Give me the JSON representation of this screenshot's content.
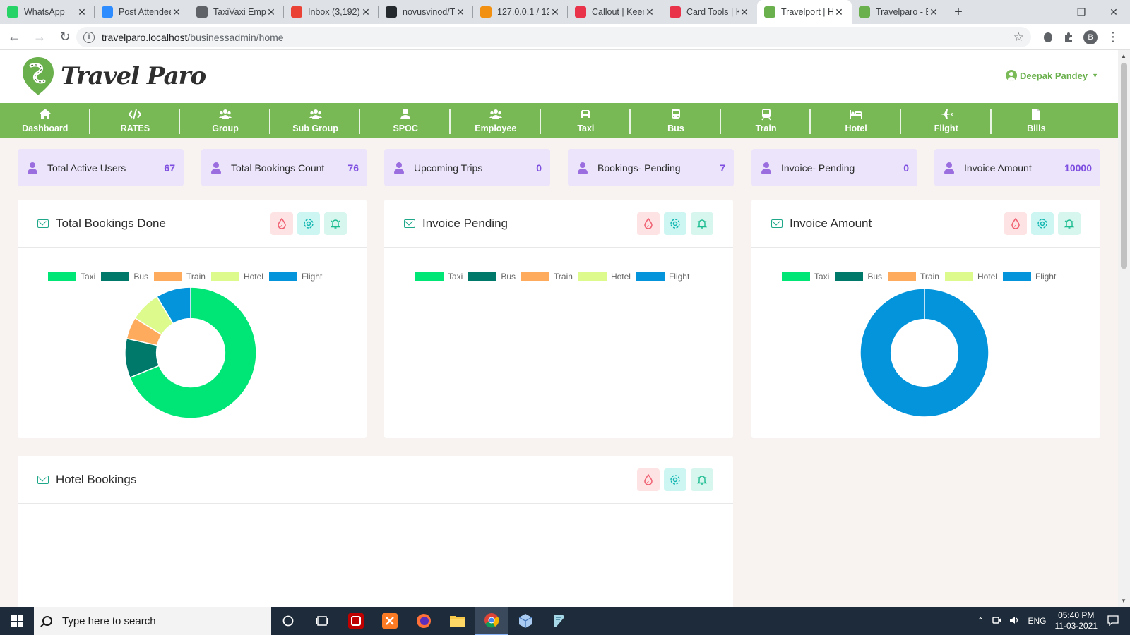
{
  "browser": {
    "tabs": [
      {
        "title": "WhatsApp",
        "icon": "whatsapp-icon",
        "color": "#25d366"
      },
      {
        "title": "Post Attendee",
        "icon": "zoom-icon",
        "color": "#2d8cff"
      },
      {
        "title": "TaxiVaxi Empl",
        "icon": "globe-icon",
        "color": "#5f6368"
      },
      {
        "title": "Inbox (3,192)",
        "icon": "gmail-icon",
        "color": "#ea4335"
      },
      {
        "title": "novusvinod/Tr",
        "icon": "github-icon",
        "color": "#24292e"
      },
      {
        "title": "127.0.0.1 / 12",
        "icon": "phpmyadmin-icon",
        "color": "#f29111"
      },
      {
        "title": "Callout | Keen",
        "icon": "keen-icon",
        "color": "#e8334a"
      },
      {
        "title": "Card Tools | K",
        "icon": "keen-icon",
        "color": "#e8334a"
      },
      {
        "title": "Travelport | H",
        "icon": "travelparo-icon",
        "color": "#6ab04c",
        "active": true
      },
      {
        "title": "Travelparo - B",
        "icon": "travelparo-icon",
        "color": "#6ab04c"
      }
    ],
    "url_host": "travelparo.localhost",
    "url_path": "/businessadmin/home",
    "profile_initial": "B"
  },
  "header": {
    "logo_text": "Travel Paro",
    "user_name": "Deepak Pandey"
  },
  "nav": [
    {
      "label": "Dashboard",
      "icon": "home-icon"
    },
    {
      "label": "RATES",
      "icon": "code-icon"
    },
    {
      "label": "Group",
      "icon": "users-icon"
    },
    {
      "label": "Sub Group",
      "icon": "users-icon"
    },
    {
      "label": "SPOC",
      "icon": "user-icon"
    },
    {
      "label": "Employee",
      "icon": "users-icon"
    },
    {
      "label": "Taxi",
      "icon": "car-icon"
    },
    {
      "label": "Bus",
      "icon": "bus-icon"
    },
    {
      "label": "Train",
      "icon": "train-icon"
    },
    {
      "label": "Hotel",
      "icon": "bed-icon"
    },
    {
      "label": "Flight",
      "icon": "plane-icon"
    },
    {
      "label": "Bills",
      "icon": "file-icon"
    }
  ],
  "stats": [
    {
      "label": "Total Active Users",
      "value": "67"
    },
    {
      "label": "Total Bookings Count",
      "value": "76"
    },
    {
      "label": "Upcoming Trips",
      "value": "0"
    },
    {
      "label": "Bookings- Pending",
      "value": "7"
    },
    {
      "label": "Invoice- Pending",
      "value": "0"
    },
    {
      "label": "Invoice Amount",
      "value": "10000"
    }
  ],
  "panels": [
    {
      "title": "Total Bookings Done"
    },
    {
      "title": "Invoice Pending"
    },
    {
      "title": "Invoice Amount"
    },
    {
      "title": "Hotel Bookings"
    }
  ],
  "colors": {
    "taxi": "#00e676",
    "bus": "#00796b",
    "train": "#ffab5e",
    "hotel": "#ddfa8c",
    "flight": "#0394dc",
    "nav_green": "#78b956"
  },
  "chart_data": [
    {
      "type": "pie",
      "title": "Total Bookings Done",
      "categories": [
        "Taxi",
        "Bus",
        "Train",
        "Hotel",
        "Flight"
      ],
      "values": [
        64,
        9,
        5,
        7,
        8
      ],
      "donut": true,
      "legend": "top"
    },
    {
      "type": "pie",
      "title": "Invoice Pending",
      "categories": [
        "Taxi",
        "Bus",
        "Train",
        "Hotel",
        "Flight"
      ],
      "values": [
        0,
        0,
        0,
        0,
        0
      ],
      "donut": true,
      "legend": "top"
    },
    {
      "type": "pie",
      "title": "Invoice Amount",
      "categories": [
        "Taxi",
        "Bus",
        "Train",
        "Hotel",
        "Flight"
      ],
      "values": [
        0,
        0,
        0,
        0,
        10000
      ],
      "donut": true,
      "legend": "top"
    }
  ],
  "taskbar": {
    "search_placeholder": "Type here to search",
    "language": "ENG",
    "time": "05:40 PM",
    "date": "11-03-2021"
  }
}
